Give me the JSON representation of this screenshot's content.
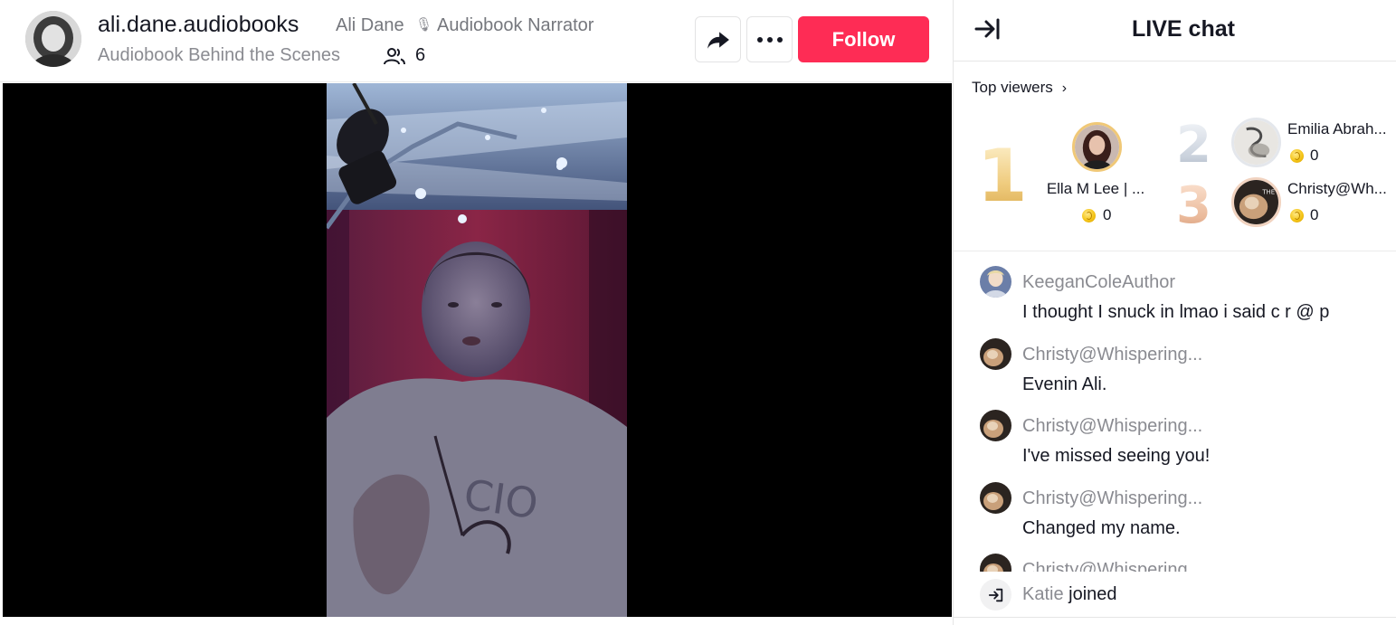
{
  "header": {
    "username": "ali.dane.audiobooks",
    "nickname": "Ali Dane",
    "role_icon": "microphone-icon",
    "role": "Audiobook Narrator",
    "live_title": "Audiobook Behind the Scenes",
    "viewer_count": "6",
    "follow_label": "Follow",
    "icons": {
      "share": "share-arrow-icon",
      "more": "more-dots-icon",
      "viewers": "viewers-icon"
    }
  },
  "chat": {
    "title": "LIVE chat",
    "collapse_icon": "collapse-right-icon",
    "top_viewers_label": "Top viewers",
    "top_viewers": [
      {
        "rank": "1",
        "name": "Ella M Lee | ...",
        "score": "0"
      },
      {
        "rank": "2",
        "name": "Emilia Abrah...",
        "score": "0"
      },
      {
        "rank": "3",
        "name": "Christy@Wh...",
        "score": "0"
      }
    ],
    "messages": [
      {
        "user": "KeeganColeAuthor",
        "text": "I thought I snuck in lmao i said c r @ p"
      },
      {
        "user": "Christy@Whispering...",
        "text": "Evenin Ali."
      },
      {
        "user": "Christy@Whispering...",
        "text": "I've missed seeing you!"
      },
      {
        "user": "Christy@Whispering...",
        "text": "Changed my name."
      },
      {
        "user": "Christy@Whispering",
        "text": ""
      }
    ],
    "join": {
      "user": "Katie",
      "action": "joined",
      "icon": "join-arrow-icon"
    }
  },
  "colors": {
    "accent": "#fe2c55",
    "muted_text": "#8a8b91",
    "gold": "#efcb7d"
  }
}
